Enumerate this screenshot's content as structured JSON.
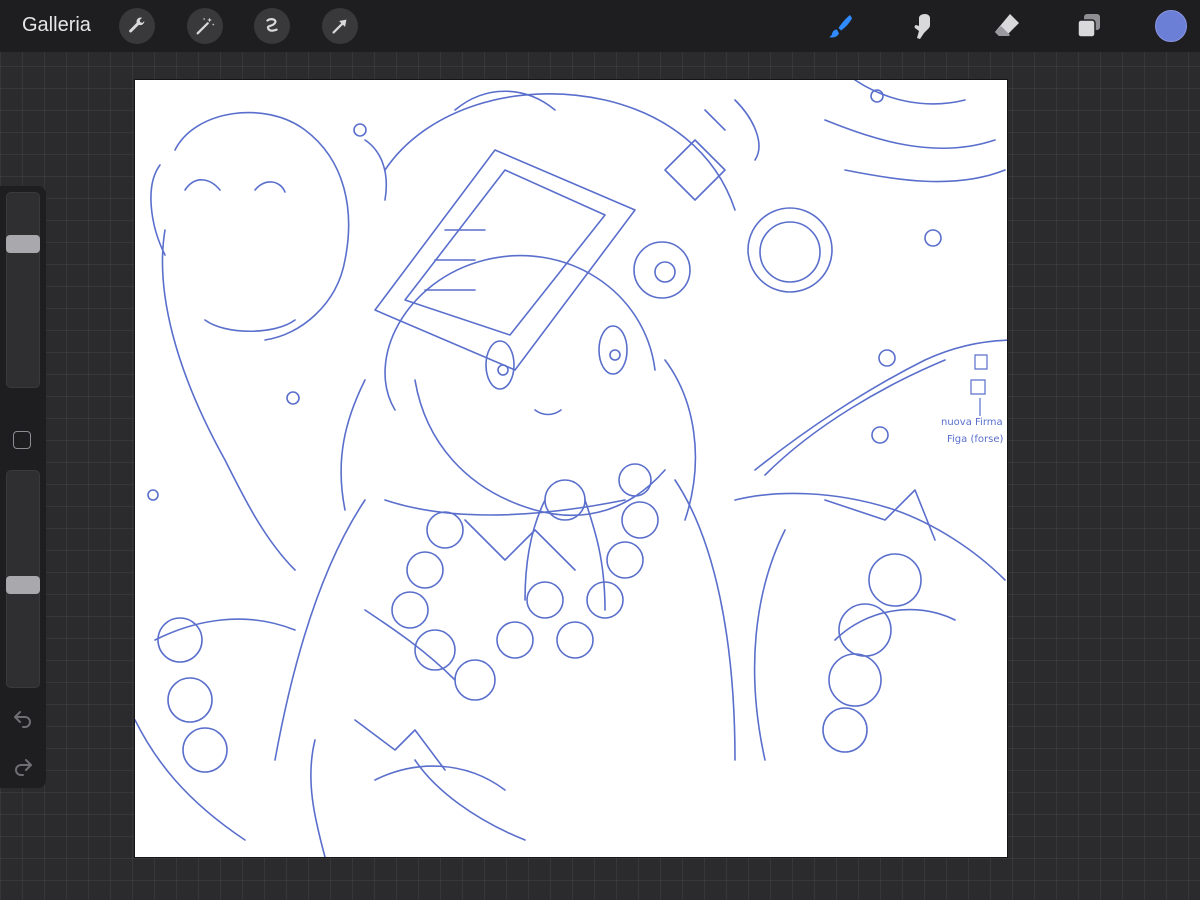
{
  "topbar": {
    "gallery_label": "Galleria",
    "actions_icons": [
      "wrench-icon",
      "magic-wand-icon",
      "selection-icon",
      "transform-arrow-icon"
    ],
    "right_tools": [
      "brush-icon",
      "smudge-icon",
      "eraser-icon",
      "layers-icon"
    ],
    "active_tool": "brush",
    "current_color": "#6b7fd7",
    "accent_color": "#2f8bff"
  },
  "sidebar": {
    "brush_size_level": 0.76,
    "opacity_level": 0.47,
    "icons": [
      "modifier-square-icon",
      "undo-icon",
      "redo-icon"
    ]
  },
  "canvas": {
    "stroke_color": "#5a6fcc",
    "notes": [
      "nuova Firma",
      "Figa (forse)"
    ]
  }
}
